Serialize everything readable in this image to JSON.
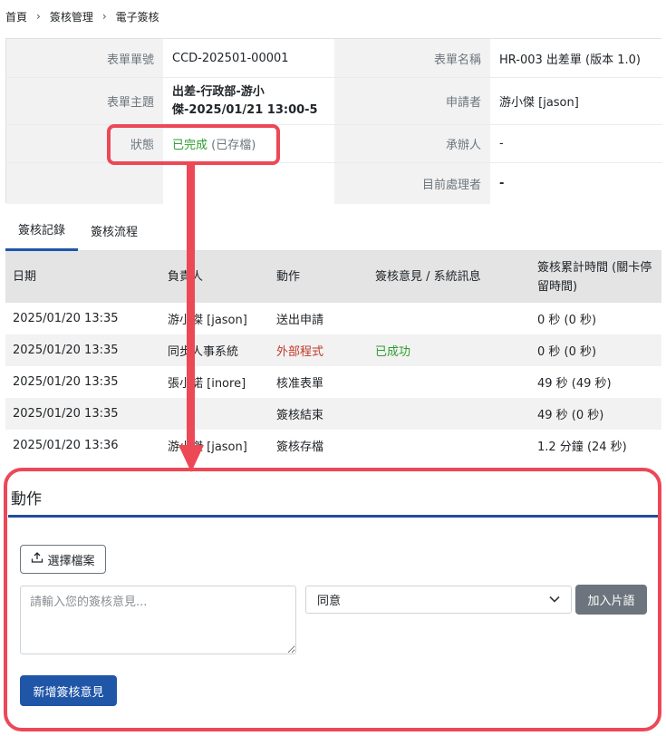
{
  "breadcrumb": {
    "items": [
      "首頁",
      "簽核管理",
      "電子簽核"
    ]
  },
  "info": {
    "form_no_label": "表單單號",
    "form_no": "CCD-202501-00001",
    "form_name_label": "表單名稱",
    "form_name": "HR-003 出差單 (版本 1.0)",
    "subject_label": "表單主題",
    "subject_line1": "出差-行政部-游小",
    "subject_line2": "傑-2025/01/21 13:00-5",
    "applicant_label": "申請者",
    "applicant": "游小傑 [jason]",
    "status_label": "狀態",
    "status_main": "已完成",
    "status_sub": "(已存檔)",
    "handler_label": "承辦人",
    "handler": "-",
    "current_label": "目前處理者",
    "current": "-"
  },
  "tabs": [
    "簽核記錄",
    "簽核流程"
  ],
  "table": {
    "headers": [
      "日期",
      "負責人",
      "動作",
      "簽核意見 / 系統訊息",
      "簽核累計時間 (關卡停留時間)"
    ],
    "rows": [
      {
        "date": "2025/01/20 13:35",
        "person": "游小傑 [jason]",
        "action": "送出申請",
        "comment": "",
        "time": "0 秒 (0 秒)"
      },
      {
        "date": "2025/01/20 13:35",
        "person": "同步人事系統",
        "action": "外部程式",
        "comment": "已成功",
        "time": "0 秒 (0 秒)"
      },
      {
        "date": "2025/01/20 13:35",
        "person": "張小諾 [inore]",
        "action": "核准表單",
        "comment": "",
        "time": "49 秒 (49 秒)"
      },
      {
        "date": "2025/01/20 13:35",
        "person": "",
        "action": "簽核結束",
        "comment": "",
        "time": "49 秒 (0 秒)"
      },
      {
        "date": "2025/01/20 13:36",
        "person": "游小傑 [jason]",
        "action": "簽核存檔",
        "comment": "",
        "time": "1.2 分鐘 (24 秒)"
      }
    ]
  },
  "action_panel": {
    "title": "動作",
    "file_button": "選擇檔案",
    "comment_placeholder": "請輸入您的簽核意見...",
    "select_value": "同意",
    "phrase_button": "加入片語",
    "add_button": "新增簽核意見"
  },
  "colors": {
    "accent": "#1f56a8",
    "success": "#2e9e2e",
    "external": "#c0392b",
    "annotation": "#ec4856"
  }
}
